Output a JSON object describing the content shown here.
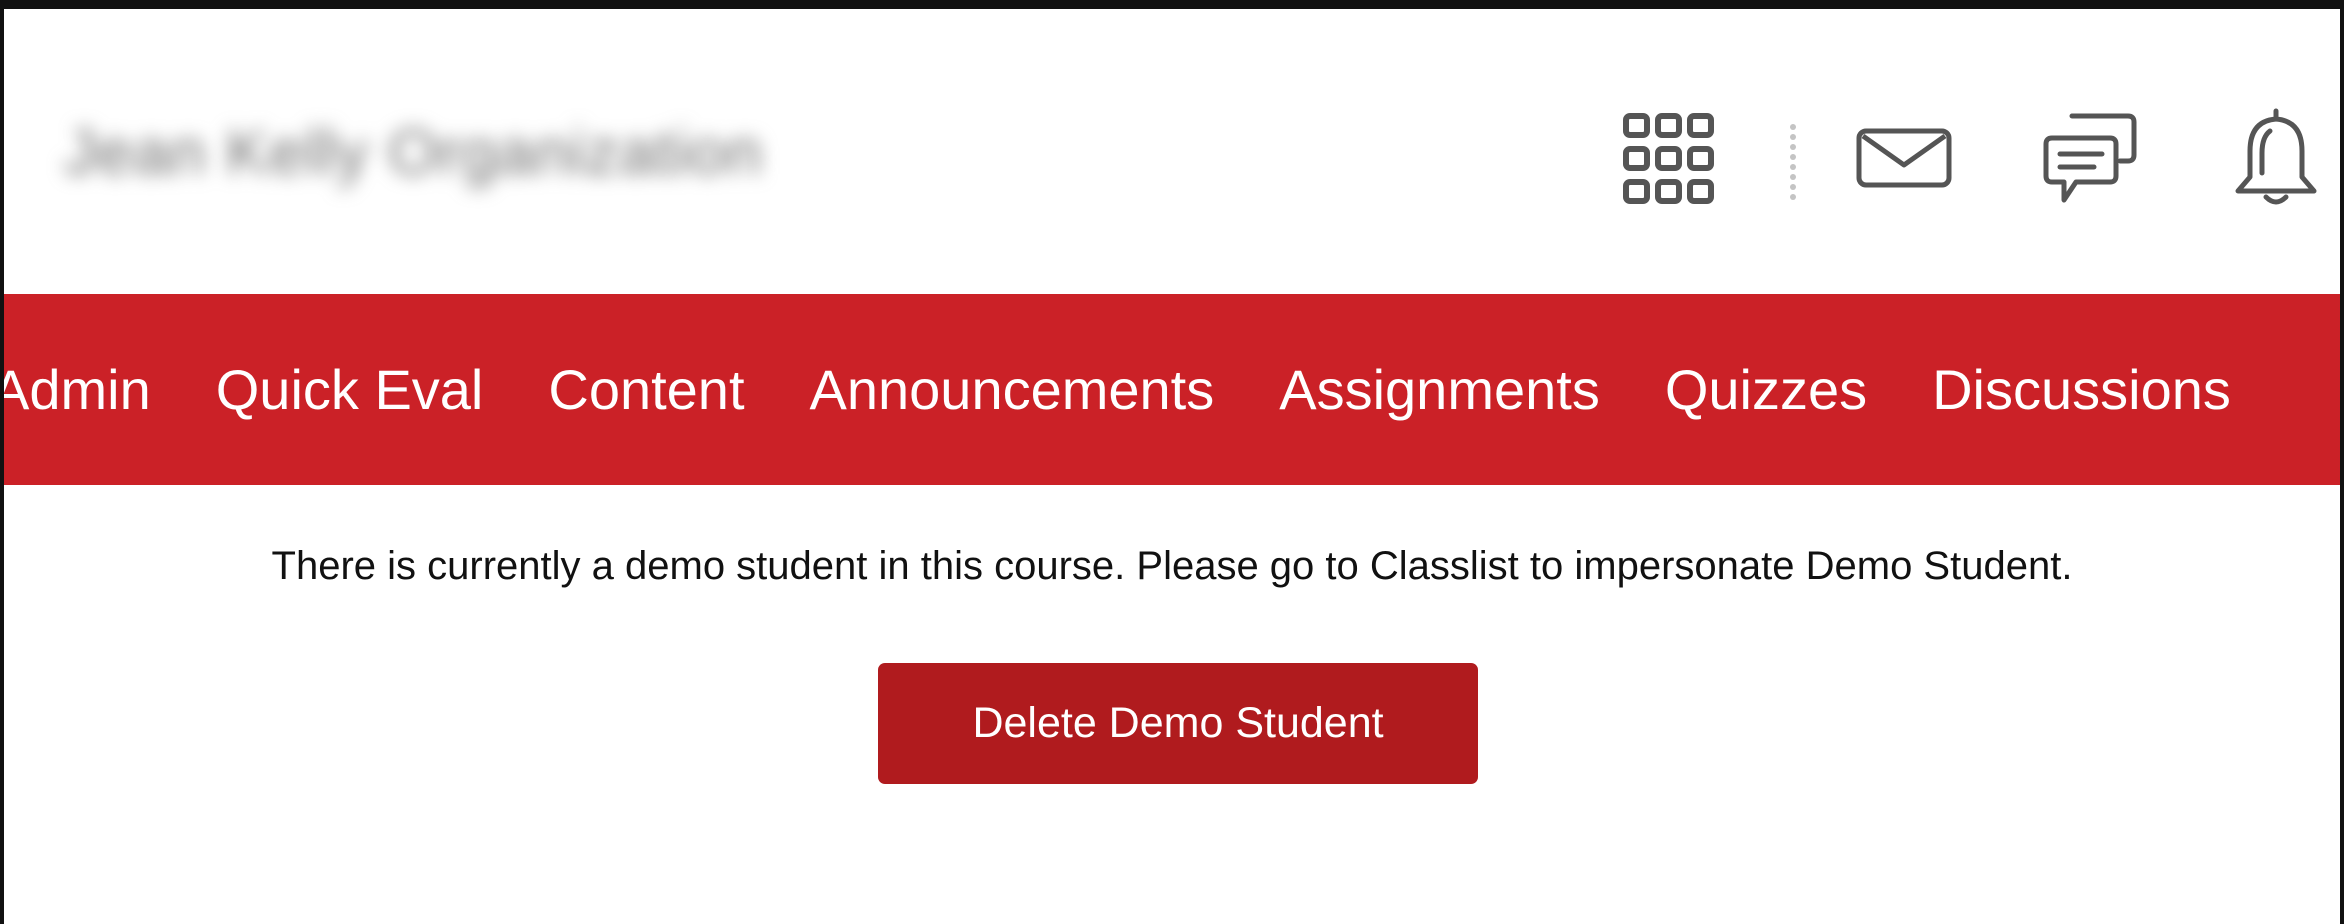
{
  "header": {
    "org_name": "Jean Kelly Organization",
    "icons": [
      "waffle-icon",
      "mail-icon",
      "chat-icon",
      "bell-icon"
    ]
  },
  "nav": {
    "items": [
      {
        "label": "Admin"
      },
      {
        "label": "Quick Eval"
      },
      {
        "label": "Content"
      },
      {
        "label": "Announcements"
      },
      {
        "label": "Assignments"
      },
      {
        "label": "Quizzes"
      },
      {
        "label": "Discussions"
      }
    ]
  },
  "main": {
    "notice": "There is currently a demo student in this course. Please go to Classlist to impersonate Demo Student.",
    "delete_button_label": "Delete Demo Student"
  },
  "colors": {
    "nav_background": "#cb2127",
    "button_background": "#b01b1e",
    "icon_color": "#555555"
  }
}
